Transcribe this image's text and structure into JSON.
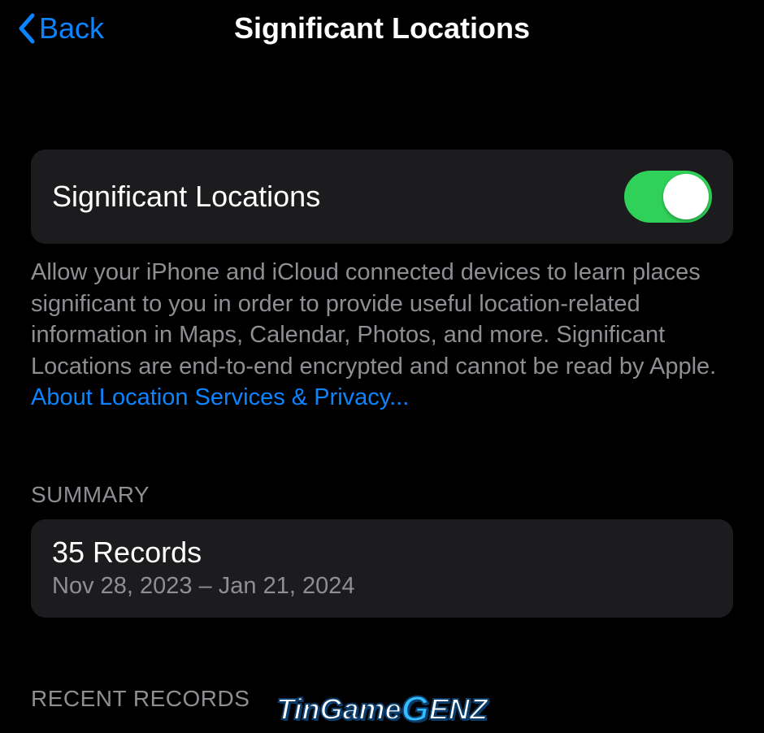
{
  "header": {
    "back_label": "Back",
    "title": "Significant Locations"
  },
  "toggle": {
    "label": "Significant Locations",
    "state": true
  },
  "description": "Allow your iPhone and iCloud connected devices to learn places significant to you in order to provide useful location-related information in Maps, Calendar, Photos, and more. Significant Locations are end-to-end encrypted and cannot be read by Apple.",
  "privacy_link": "About Location Services & Privacy...",
  "summary": {
    "header": "SUMMARY",
    "title": "35 Records",
    "subtitle": "Nov 28, 2023 – Jan 21, 2024"
  },
  "recent_records": {
    "header": "RECENT RECORDS"
  },
  "watermark": {
    "part1": "TinGame",
    "part2": "G",
    "part3": "ENZ"
  },
  "colors": {
    "accent": "#0a84ff",
    "switch_on": "#30d158",
    "card_bg": "#1c1c1e",
    "text_secondary": "#8e8e93"
  }
}
